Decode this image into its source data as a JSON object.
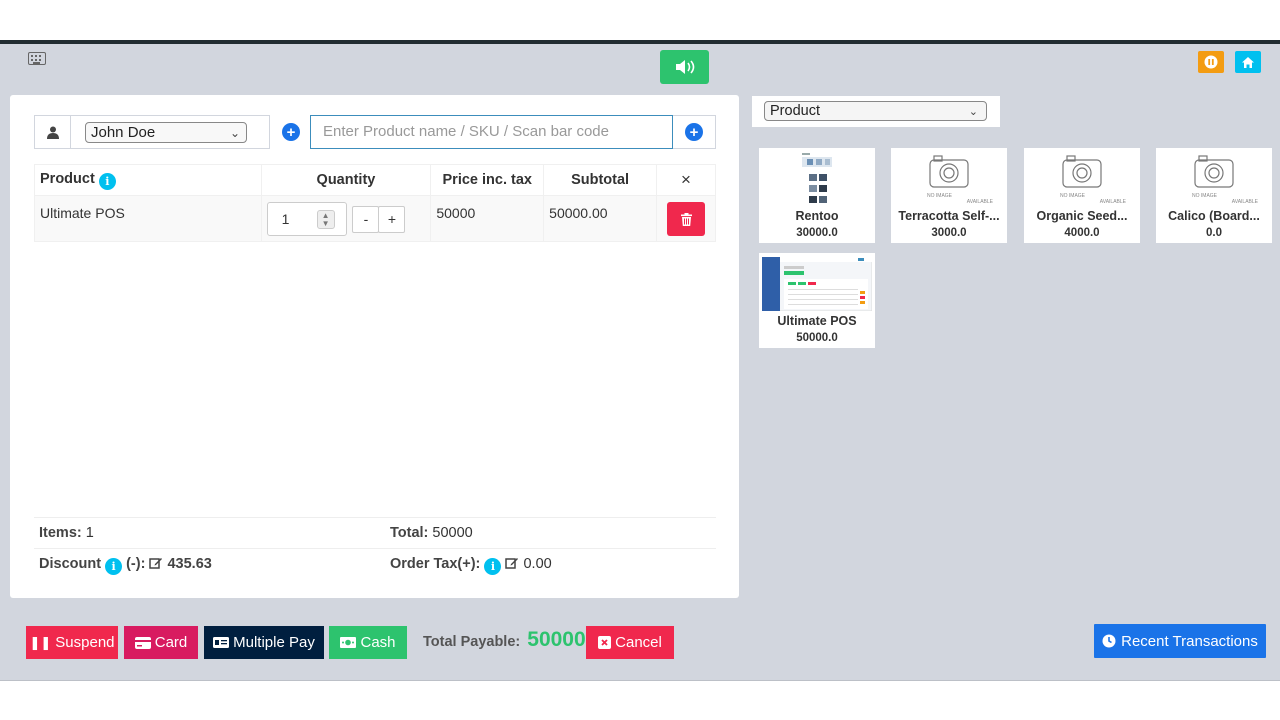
{
  "colors": {
    "accent_green": "#2dc36e",
    "primary_blue": "#1a73e8",
    "danger": "#f0284d",
    "cyan": "#00c0ef"
  },
  "customer": {
    "selected": "John Doe",
    "icon": "user-icon"
  },
  "search": {
    "placeholder": "Enter Product name / SKU / Scan bar code"
  },
  "cart": {
    "headers": {
      "product": "Product",
      "quantity": "Quantity",
      "price": "Price inc. tax",
      "subtotal": "Subtotal",
      "remove": "×"
    },
    "rows": [
      {
        "product": "Ultimate POS",
        "quantity": "1",
        "minus": "-",
        "plus": "+",
        "price": "50000",
        "subtotal": "50000.00"
      }
    ]
  },
  "totals": {
    "items_label": "Items:",
    "items_value": "1",
    "total_label": "Total:",
    "total_value": "50000",
    "discount_label": "Discount",
    "discount_sign": "(-):",
    "discount_value": "435.63",
    "tax_label": "Order Tax(+):",
    "tax_value": "0.00"
  },
  "footer": {
    "suspend": "Suspend",
    "card": "Card",
    "multiple_pay": "Multiple Pay",
    "cash": "Cash",
    "total_payable_label": "Total Payable:",
    "total_payable_value": "50000",
    "cancel": "Cancel",
    "recent": "Recent Transactions"
  },
  "category": {
    "selected": "Product"
  },
  "products": [
    {
      "name": "Rentoo",
      "price": "30000.0",
      "image": "product-thumbnail"
    },
    {
      "name": "Terracotta Self-...",
      "price": "3000.0",
      "image": "no-image"
    },
    {
      "name": "Organic Seed...",
      "price": "4000.0",
      "image": "no-image"
    },
    {
      "name": "Calico (Board...",
      "price": "0.0",
      "image": "no-image"
    },
    {
      "name": "Ultimate POS",
      "price": "50000.0",
      "image": "product-thumbnail"
    }
  ],
  "no_image_text": {
    "line1": "NO IMAGE",
    "line2": "AVAILABLE"
  }
}
